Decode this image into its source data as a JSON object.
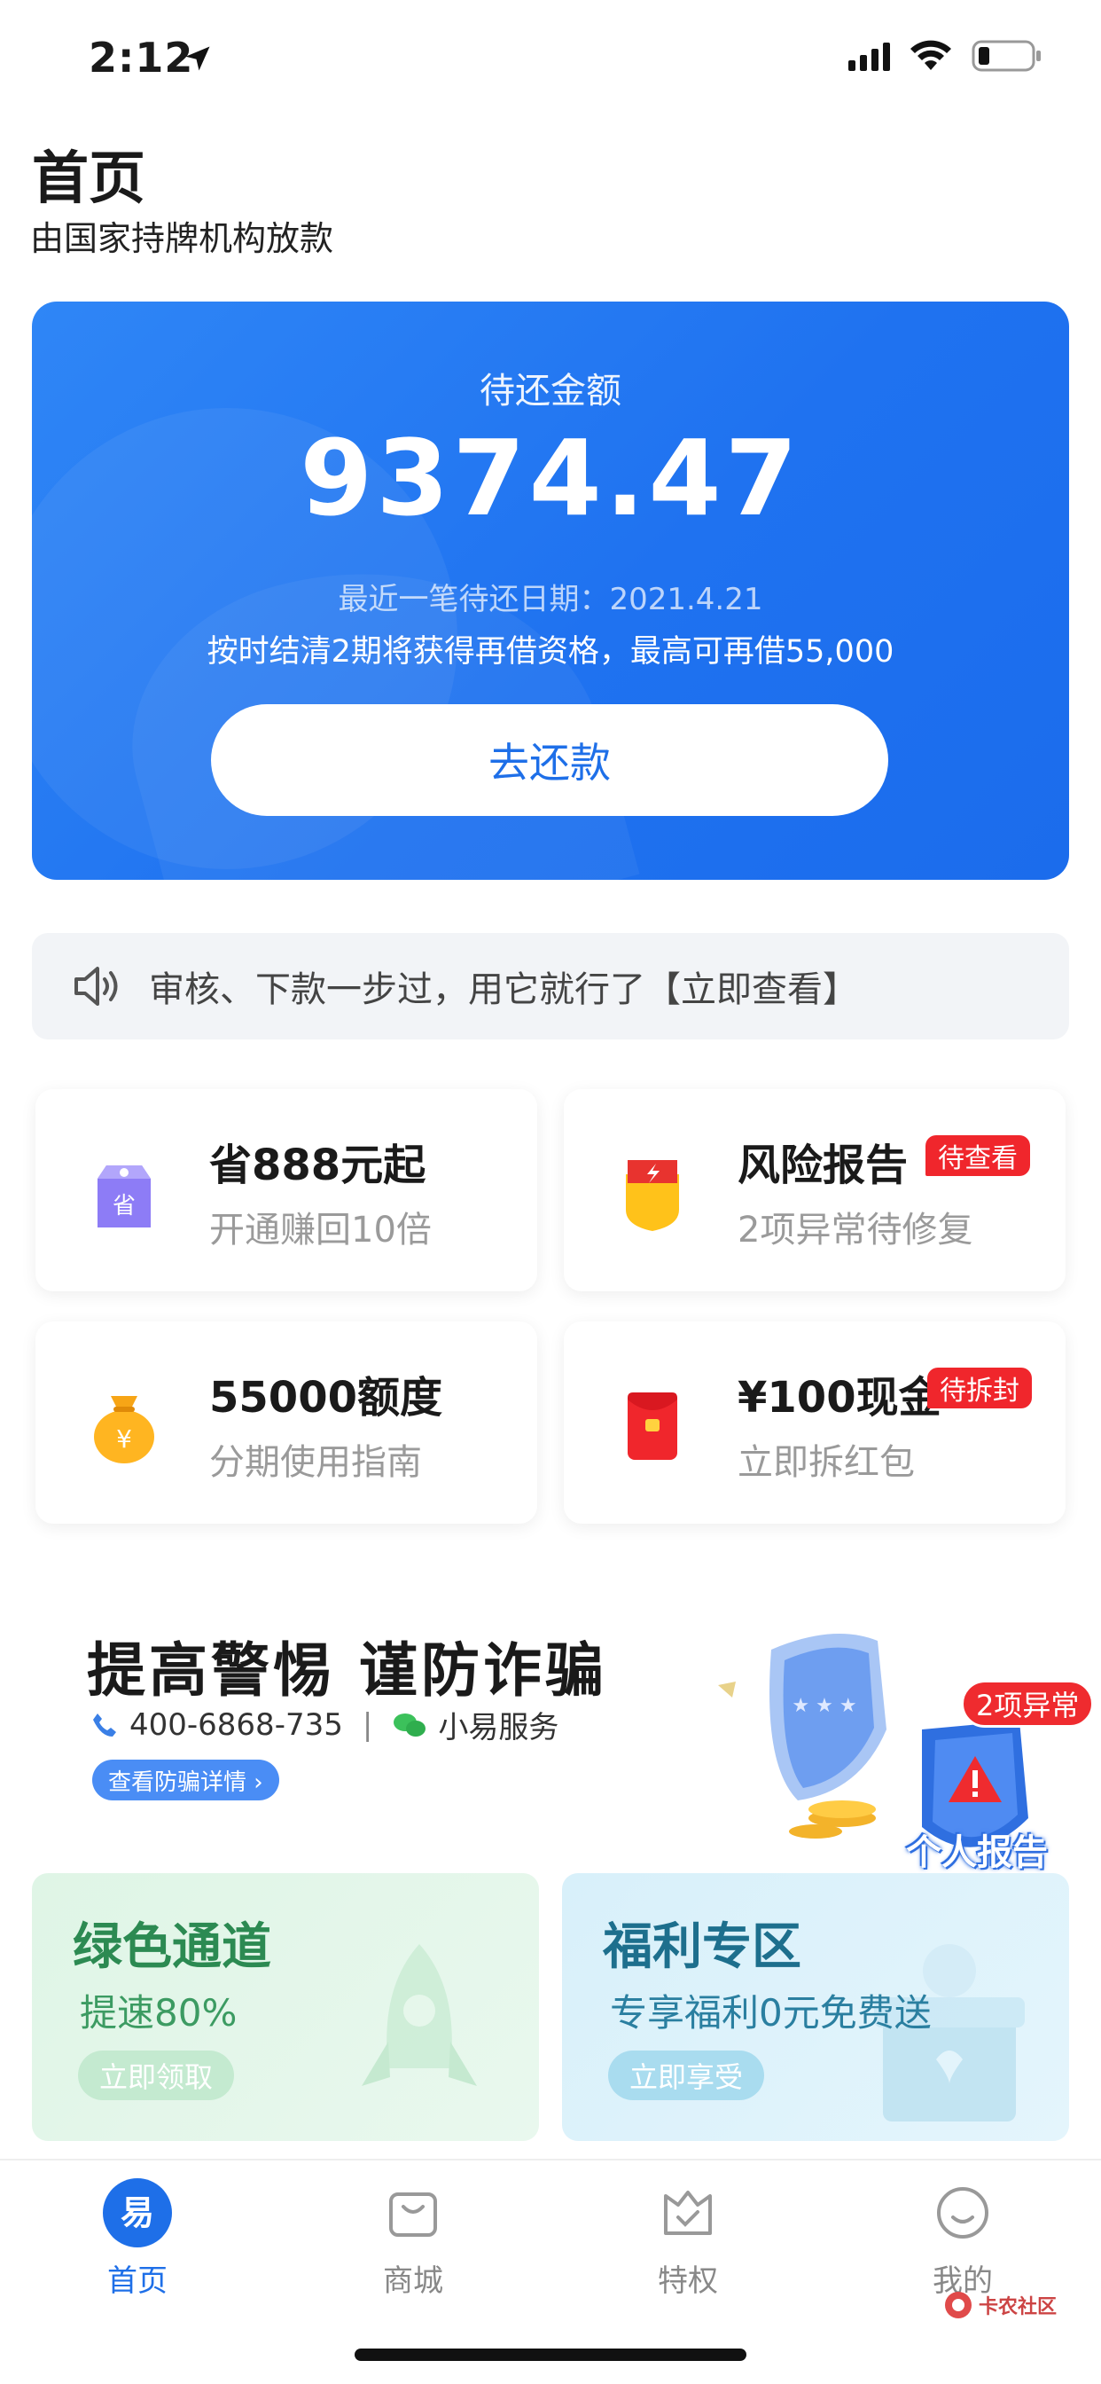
{
  "status_bar": {
    "time": "2:12"
  },
  "header": {
    "title": "首页",
    "subtitle": "由国家持牌机构放款"
  },
  "hero": {
    "label": "待还金额",
    "amount": "9374.47",
    "due_date": "最近一笔待还日期：2021.4.21",
    "tip": "按时结清2期将获得再借资格，最高可再借55,000",
    "button": "去还款"
  },
  "notice": {
    "text": "审核、下款一步过，用它就行了【立即查看】"
  },
  "features": [
    {
      "title": "省888元起",
      "subtitle": "开通赚回10倍",
      "badge": "",
      "icon": "discount-tag-icon"
    },
    {
      "title": "风险报告",
      "subtitle": "2项异常待修复",
      "badge": "待查看",
      "icon": "risk-shield-icon"
    },
    {
      "title": "55000额度",
      "subtitle": "分期使用指南",
      "badge": "",
      "icon": "money-bag-icon"
    },
    {
      "title": "¥100现金",
      "subtitle": "立即拆红包",
      "badge": "待拆封",
      "icon": "red-envelope-icon"
    }
  ],
  "fraud_banner": {
    "title": "提高警惕 谨防诈骗",
    "phone": "400-6868-735",
    "separator": "|",
    "service": "小易服务",
    "button": "查看防骗详情 ›",
    "badge": "2项异常",
    "report_label": "个人报告"
  },
  "promos": [
    {
      "title": "绿色通道",
      "subtitle": "提速80%",
      "button": "立即领取"
    },
    {
      "title": "福利专区",
      "subtitle": "专享福利0元免费送",
      "button": "立即享受"
    }
  ],
  "tabbar": [
    {
      "label": "首页",
      "active": true,
      "icon": "home-logo-icon"
    },
    {
      "label": "商城",
      "active": false,
      "icon": "shopping-bag-icon"
    },
    {
      "label": "特权",
      "active": false,
      "icon": "privilege-icon"
    },
    {
      "label": "我的",
      "active": false,
      "icon": "profile-smile-icon"
    }
  ],
  "watermark": {
    "text": "卡农社区"
  },
  "colors": {
    "primary": "#1e6fe8",
    "badge_red": "#f0262c",
    "green": "#2c8a52"
  }
}
